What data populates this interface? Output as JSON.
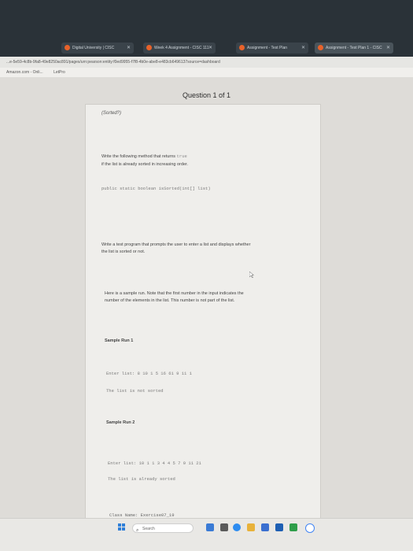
{
  "browser": {
    "tabs": [
      {
        "label": "Digital University | CISC"
      },
      {
        "label": "Week 4 Assignment - CISC 111"
      },
      {
        "label": "Assignment - Test Plan"
      },
      {
        "label": "Assignment - Test Plan 1 - CISC"
      }
    ],
    "url": "...e-5e59-4c8b-9fa8-49e8250ac891/pages/urn:pearson:entity:f0ed9955-f7f8-4b0e-abe8-e483cb6496137source=dashboard",
    "bookmarks": [
      "Amazon.com - Onli...",
      "LetPro"
    ]
  },
  "page": {
    "heading": "Question 1 of 1",
    "title": "(Sorted?)",
    "p1_line1_prefix": "Write the following method that returns ",
    "p1_code": "true",
    "p1_line2": "if the list is already sorted in increasing order.",
    "signature": "public static boolean isSorted(int[] list)",
    "p2_line1": "Write a test program that prompts the user to enter a list and displays whether",
    "p2_line2": "the list is sorted or not.",
    "p3_line1": "Here is a sample run. Note that the first number in the input indicates the",
    "p3_line2": "number of the elements in the list. This number is not part of the list.",
    "run1_title": "Sample Run 1",
    "run1_input": "Enter list: 8 10 1 5 16 61 9 11 1",
    "run1_output": "The list is not sorted",
    "run2_title": "Sample Run 2",
    "run2_input": "Enter list: 10 1 1 3 4 4 5 7 9 11 21",
    "run2_output": "The list is already sorted",
    "footer_partial": "Class Name: Exercise07_19"
  },
  "taskbar": {
    "search_label": "Search"
  },
  "colors": {
    "tabbar": "#2a3238",
    "card": "#efeeeb",
    "accent": "#e8622a"
  }
}
